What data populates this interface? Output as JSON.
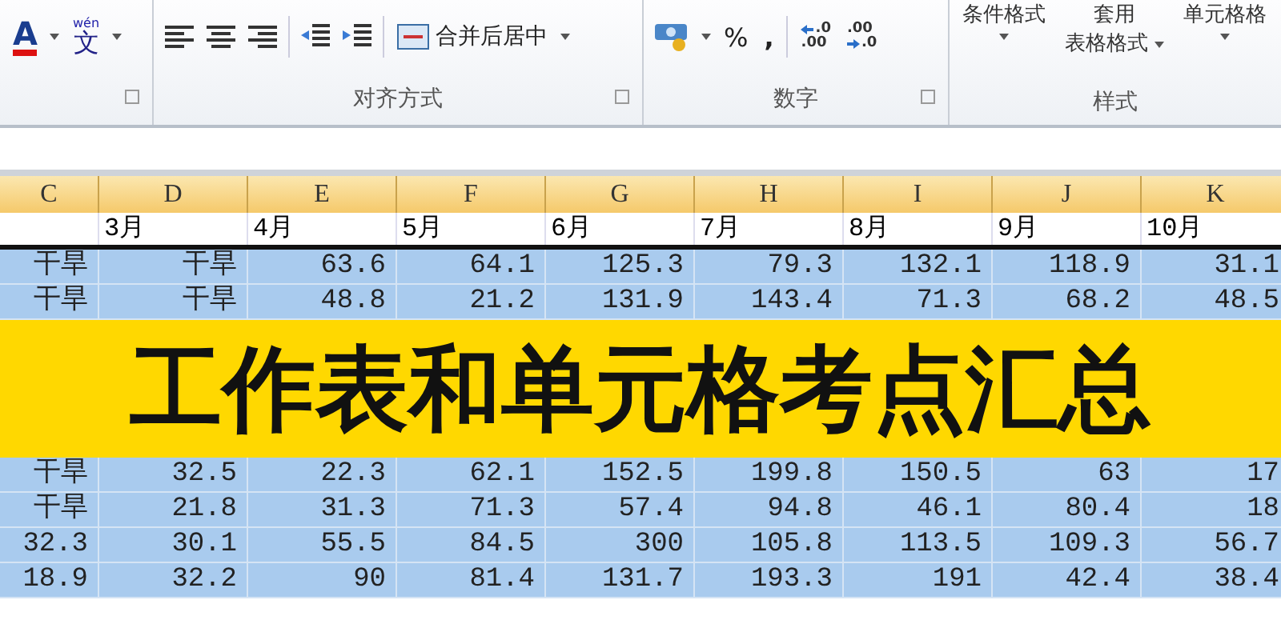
{
  "ribbon": {
    "font_color_button": {
      "label": "A"
    },
    "phonetic_button": {
      "ruby": "wén",
      "label": "文"
    },
    "alignment_group": {
      "label": "对齐方式",
      "merge_button": "合并后居中"
    },
    "number_group": {
      "label": "数字",
      "percent_button": "%",
      "comma_button": ",",
      "increase_decimal": {
        "top": ".0",
        "bottom": ".00"
      },
      "decrease_decimal": {
        "top": ".00",
        "bottom": ".0"
      }
    },
    "styles_group": {
      "label": "样式",
      "buttons": [
        {
          "lines": [
            "条件格式"
          ],
          "kind": "caret-below"
        },
        {
          "lines": [
            "套用",
            "表格格式"
          ],
          "kind": "caret-inline"
        },
        {
          "lines": [
            "单元格格"
          ],
          "kind": "caret-below"
        }
      ]
    }
  },
  "sheet": {
    "columns": [
      "C",
      "D",
      "E",
      "F",
      "G",
      "H",
      "I",
      "J",
      "K"
    ],
    "month_row": [
      "3月",
      "4月",
      "5月",
      "6月",
      "7月",
      "8月",
      "9月",
      "10月"
    ],
    "rows_top": [
      {
        "cells": [
          "干旱",
          "干旱",
          "63.6",
          "64.1",
          "125.3",
          "79.3",
          "132.1",
          "118.9",
          "31.1"
        ]
      },
      {
        "cells": [
          "干旱",
          "干旱",
          "48.8",
          "21.2",
          "131.9",
          "143.4",
          "71.3",
          "68.2",
          "48.5"
        ]
      }
    ],
    "rows_bottom": [
      {
        "cells": [
          "干旱",
          "32.5",
          "22.3",
          "62.1",
          "152.5",
          "199.8",
          "150.5",
          "63",
          "17"
        ]
      },
      {
        "cells": [
          "干旱",
          "21.8",
          "31.3",
          "71.3",
          "57.4",
          "94.8",
          "46.1",
          "80.4",
          "18"
        ]
      },
      {
        "cells": [
          "32.3",
          "30.1",
          "55.5",
          "84.5",
          "300",
          "105.8",
          "113.5",
          "109.3",
          "56.7"
        ]
      },
      {
        "cells": [
          "18.9",
          "32.2",
          "90",
          "81.4",
          "131.7",
          "193.3",
          "191",
          "42.4",
          "38.4"
        ]
      }
    ]
  },
  "banner": {
    "title": "工作表和单元格考点汇总"
  }
}
